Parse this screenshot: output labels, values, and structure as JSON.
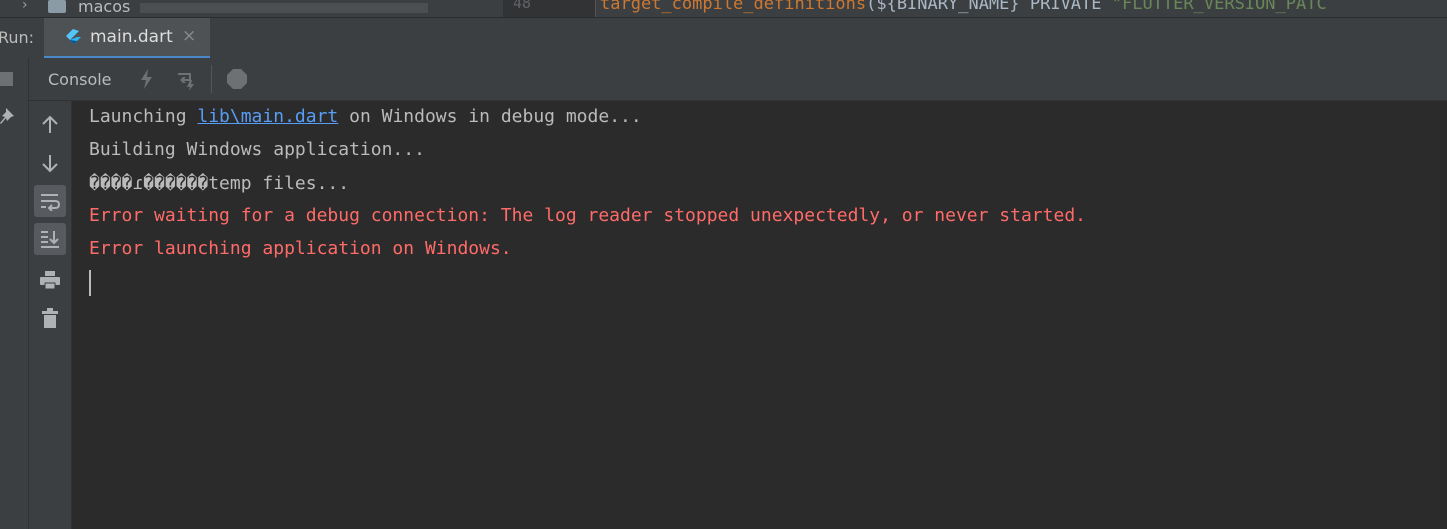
{
  "project_tree": {
    "folder_name": "macos"
  },
  "editor_peek": {
    "line_number": "48",
    "code_keyword": "target_compile_definitions",
    "code_args": "(${BINARY_NAME} PRIVATE ",
    "code_string": "\"FLUTTER_VERSION_PATC"
  },
  "run_panel": {
    "label": "Run:",
    "tab_name": "main.dart",
    "tab_close_glyph": "×"
  },
  "console_toolbar": {
    "console_label": "Console",
    "icons": [
      "hot-reload-icon",
      "hot-restart-icon",
      "stop-icon"
    ]
  },
  "side_toolbar": {
    "icons": [
      "arrow-up-icon",
      "arrow-down-icon",
      "soft-wrap-icon",
      "scroll-to-end-icon",
      "print-icon",
      "trash-icon"
    ]
  },
  "console": {
    "line1_prefix": "Launching ",
    "line1_link": "lib\\main.dart",
    "line1_suffix": " on Windows in debug mode...",
    "line2": "Building Windows application...",
    "line3": "����ɾ������temp files...",
    "line4": "Error waiting for a debug connection: The log reader stopped unexpectedly, or never started.",
    "line5": "Error launching application on Windows."
  },
  "colors": {
    "background": "#2b2b2b",
    "panel": "#3c3f41",
    "text": "#bbbbbb",
    "error": "#ff6b68",
    "link": "#589df6",
    "tab_accent": "#4a88c7"
  }
}
